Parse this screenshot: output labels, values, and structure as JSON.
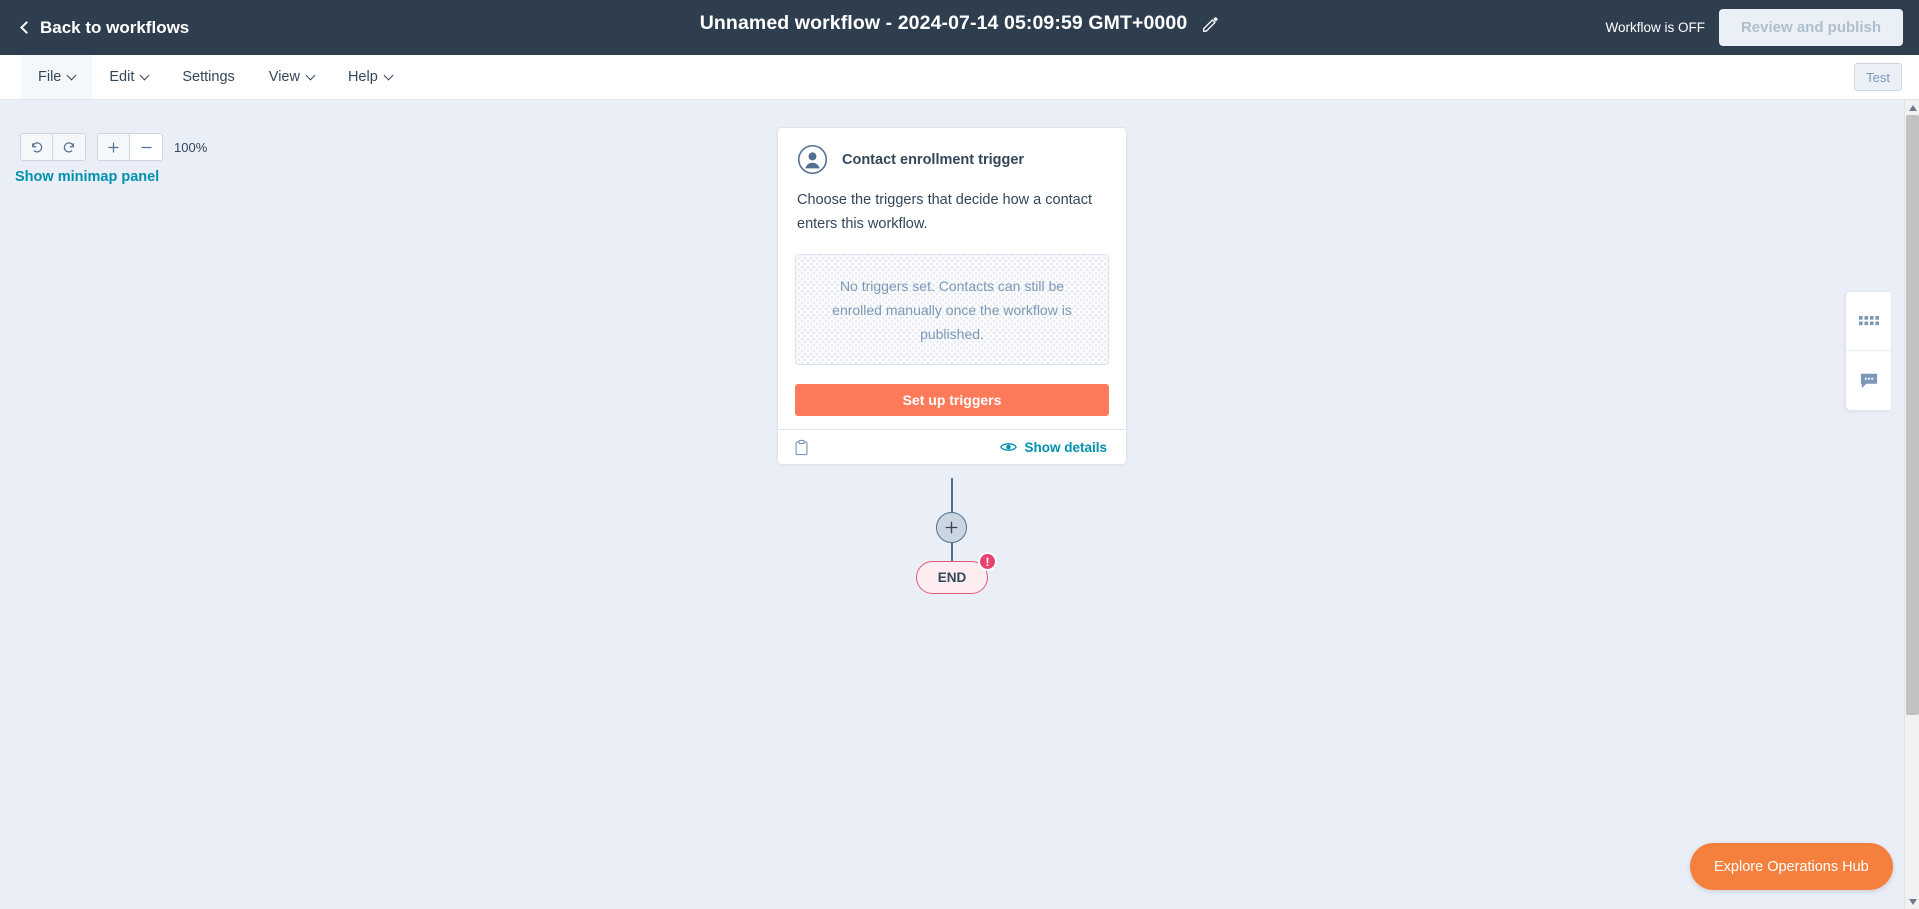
{
  "topbar": {
    "back_label": "Back to workflows",
    "back_icon": "chevron-left-icon",
    "title": "Unnamed workflow - 2024-07-14 05:09:59 GMT+0000",
    "edit_icon": "pencil-icon",
    "status_label": "Workflow is OFF",
    "publish_label": "Review and publish",
    "bg_color": "#2e3e4f"
  },
  "menubar": {
    "items": [
      {
        "label": "File",
        "has_caret": true,
        "active": true
      },
      {
        "label": "Edit",
        "has_caret": true,
        "active": false
      },
      {
        "label": "Settings",
        "has_caret": false,
        "active": false
      },
      {
        "label": "View",
        "has_caret": true,
        "active": false
      },
      {
        "label": "Help",
        "has_caret": true,
        "active": false
      }
    ],
    "test_label": "Test"
  },
  "canvas": {
    "bg_color": "#eaeef7",
    "zoom": {
      "undo_icon": "undo-icon",
      "redo_icon": "redo-icon",
      "zoom_in_icon": "plus-icon",
      "zoom_out_icon": "minus-icon",
      "level": "100%"
    },
    "minimap_link": "Show minimap panel",
    "link_color": "#0091ae"
  },
  "trigger_card": {
    "icon": "contact-person-icon",
    "title": "Contact enrollment trigger",
    "description": "Choose the triggers that decide how a contact enters this workflow.",
    "empty_state": "No triggers set. Contacts can still be enrolled manually once the workflow is published.",
    "primary_button": "Set up triggers",
    "primary_button_color": "#ff7a59",
    "clipboard_icon": "clipboard-icon",
    "details_icon": "eye-icon",
    "details_label": "Show details"
  },
  "flow": {
    "add_node_icon": "plus-icon",
    "end_label": "END",
    "end_badge": "!",
    "end_badge_color": "#e8426f",
    "end_border_color": "#e05c78"
  },
  "side_panel": {
    "buttons": [
      {
        "icon": "apps-grid-icon"
      },
      {
        "icon": "chat-bubble-icon"
      }
    ]
  },
  "ops_hub": {
    "label": "Explore Operations Hub",
    "color": "#f5803e"
  },
  "scrollbar": {
    "up_icon": "caret-up-icon",
    "down_icon": "caret-down-icon"
  }
}
